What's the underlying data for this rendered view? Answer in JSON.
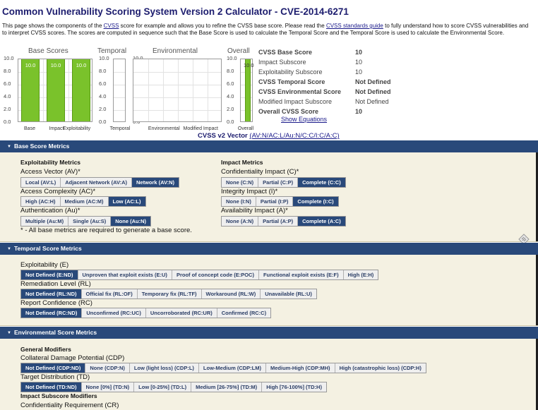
{
  "page": {
    "title": "Common Vulnerability Scoring System Version 2 Calculator - CVE-2014-6271",
    "intro_1": "This page shows the components of the ",
    "intro_link_1": "CVSS",
    "intro_2": " score for example and allows you to refine the CVSS base score. Please read the ",
    "intro_link_2": "CVSS standards guide",
    "intro_3": " to fully understand how to score CVSS vulnerabilities and to interpret CVSS scores. The scores are computed in sequence such that the Base Score is used to calculate the Temporal Score and the Temporal Score is used to calculate the Environmental Score."
  },
  "chart_data": {
    "type": "bar",
    "ylim": [
      0,
      10
    ],
    "yticks": [
      "10.0",
      "8.0",
      "6.0",
      "4.0",
      "2.0",
      "0.0"
    ],
    "groups": [
      {
        "title": "Base Scores",
        "categories": [
          "Base",
          "Impact",
          "Exploitability"
        ],
        "values": [
          10,
          10,
          10
        ],
        "value_labels": [
          "10.0",
          "10.0",
          "10.0"
        ]
      },
      {
        "title": "Temporal",
        "categories": [
          "Temporal"
        ],
        "values": [
          0
        ],
        "value_labels": []
      },
      {
        "title": "Environmental",
        "categories": [
          "Environmental",
          "Modified Impact"
        ],
        "values": [
          0,
          0
        ],
        "value_labels": []
      },
      {
        "title": "Overall",
        "categories": [
          "Overall"
        ],
        "values": [
          10
        ],
        "value_labels": [
          "10.0"
        ]
      }
    ],
    "bar_color": "#7ac22b"
  },
  "scores": [
    {
      "label": "CVSS Base Score",
      "value": "10",
      "bold": true
    },
    {
      "label": "Impact Subscore",
      "value": "10",
      "bold": false
    },
    {
      "label": "Exploitability Subscore",
      "value": "10",
      "bold": false
    },
    {
      "label": "CVSS Temporal Score",
      "value": "Not Defined",
      "bold": true
    },
    {
      "label": "CVSS Environmental Score",
      "value": "Not Defined",
      "bold": true
    },
    {
      "label": "Modified Impact Subscore",
      "value": "Not Defined",
      "bold": false
    },
    {
      "label": "Overall CVSS Score",
      "value": "10",
      "bold": true
    }
  ],
  "show_equations": "Show Equations",
  "vector": {
    "label": "CVSS v2 Vector ",
    "value": "(AV:N/AC:L/Au:N/C:C/I:C/A:C)"
  },
  "base": {
    "header": "Base Score Metrics",
    "exploitability_title": "Exploitability Metrics",
    "impact_title": "Impact Metrics",
    "av_label": "Access Vector (AV)*",
    "av_options": [
      "Local (AV:L)",
      "Adjacent Network (AV:A)",
      "Network (AV:N)"
    ],
    "ac_label": "Access Complexity (AC)*",
    "ac_options": [
      "High (AC:H)",
      "Medium (AC:M)",
      "Low (AC:L)"
    ],
    "au_label": "Authentication (Au)*",
    "au_options": [
      "Multiple (Au:M)",
      "Single (Au:S)",
      "None (Au:N)"
    ],
    "c_label": "Confidentiality Impact (C)*",
    "c_options": [
      "None (C:N)",
      "Partial (C:P)",
      "Complete (C:C)"
    ],
    "i_label": "Integrity Impact (I)*",
    "i_options": [
      "None (I:N)",
      "Partial (I:P)",
      "Complete (I:C)"
    ],
    "a_label": "Availability Impact (A)*",
    "a_options": [
      "None (A:N)",
      "Partial (A:P)",
      "Complete (A:C)"
    ],
    "note": "* - All base metrics are required to generate a base score."
  },
  "temporal": {
    "header": "Temporal Score Metrics",
    "e_label": "Exploitability (E)",
    "e_options": [
      "Not Defined (E:ND)",
      "Unproven that exploit exists (E:U)",
      "Proof of concept code (E:POC)",
      "Functional exploit exists (E:F)",
      "High (E:H)"
    ],
    "rl_label": "Remediation Level (RL)",
    "rl_options": [
      "Not Defined (RL:ND)",
      "Official fix (RL:OF)",
      "Temporary fix (RL:TF)",
      "Workaround (RL:W)",
      "Unavailable (RL:U)"
    ],
    "rc_label": "Report Confidence (RC)",
    "rc_options": [
      "Not Defined (RC:ND)",
      "Unconfirmed (RC:UC)",
      "Uncorroborated (RC:UR)",
      "Confirmed (RC:C)"
    ]
  },
  "environmental": {
    "header": "Environmental Score Metrics",
    "general_title": "General Modifiers",
    "cdp_label": "Collateral Damage Potential (CDP)",
    "cdp_options": [
      "Not Defined (CDP:ND)",
      "None (CDP:N)",
      "Low (light loss) (CDP:L)",
      "Low-Medium (CDP:LM)",
      "Medium-High (CDP:MH)",
      "High (catastrophic loss) (CDP:H)"
    ],
    "td_label": "Target Distribution (TD)",
    "td_options": [
      "Not Defined (TD:ND)",
      "None [0%] (TD:N)",
      "Low [0-25%] (TD:L)",
      "Medium [26-75%] (TD:M)",
      "High [76-100%] (TD:H)"
    ],
    "impact_sub_title": "Impact Subscore Modifiers",
    "cr_label": "Confidentiality Requirement (CR)"
  },
  "selected": {
    "av": 2,
    "ac": 2,
    "au": 2,
    "c": 2,
    "i": 2,
    "a": 2,
    "e": 0,
    "rl": 0,
    "rc": 0,
    "cdp": 0,
    "td": 0
  }
}
